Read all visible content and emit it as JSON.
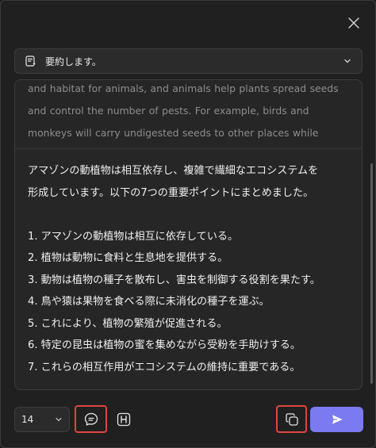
{
  "prompt": {
    "selected": "要約します。",
    "icon": "document-sparkle-icon"
  },
  "source_text": "and habitat for animals, and animals help plants spread seeds and control the number of pests. For example, birds and monkeys will carry undigested seeds to other places while eating",
  "summary": {
    "intro_line_1": "アマゾンの動植物は相互依存し、複雑で繊細なエコシステムを",
    "intro_line_2": "形成しています。以下の7つの重要ポイントにまとめました。",
    "points": [
      "1. アマゾンの動植物は相互に依存している。",
      "2. 植物は動物に食料と生息地を提供する。",
      "3. 動物は植物の種子を散布し、害虫を制御する役割を果たす。",
      "4. 鳥や猿は果物を食べる際に未消化の種子を運ぶ。",
      "5. これにより、植物の繁殖が促進される。",
      "6. 特定の昆虫は植物の蜜を集めながら受粉を手助けする。",
      "7. これらの相互作用がエコシステムの維持に重要である。"
    ]
  },
  "toolbar": {
    "font_size": "14",
    "chat_icon": "chat-bubble-icon",
    "heading_icon": "heading-h-icon",
    "copy_icon": "copy-icon",
    "send_icon": "send-icon",
    "accent": "#7b7af0",
    "highlight": "#e0453f"
  }
}
